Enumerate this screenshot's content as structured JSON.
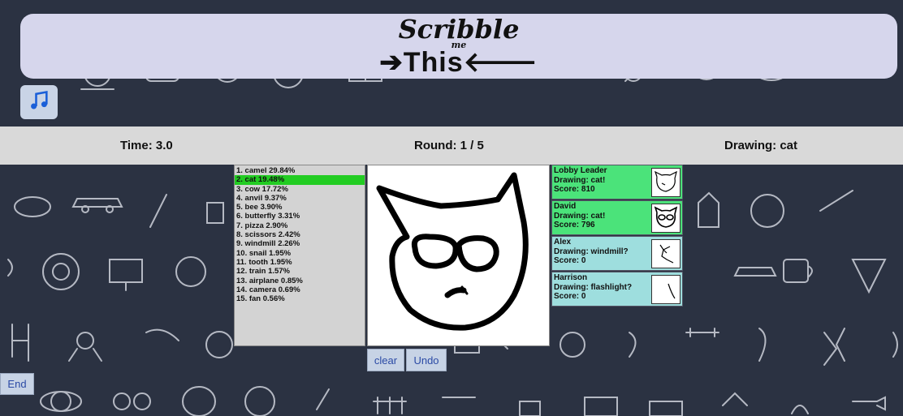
{
  "header": {
    "logo_word1": "Scribble",
    "logo_word2": "me",
    "logo_word3": "➔This🡐"
  },
  "status": {
    "time": "Time: 3.0",
    "round": "Round: 1 / 5",
    "drawing": "Drawing: cat"
  },
  "guesses": [
    {
      "label": "1. camel 29.84%"
    },
    {
      "label": "2. cat 19.48%",
      "active": true
    },
    {
      "label": "3. cow 17.72%"
    },
    {
      "label": "4. anvil 9.37%"
    },
    {
      "label": "5. bee 3.90%"
    },
    {
      "label": "6. butterfly 3.31%"
    },
    {
      "label": "7. pizza 2.90%"
    },
    {
      "label": "8. scissors 2.42%"
    },
    {
      "label": "9. windmill 2.26%"
    },
    {
      "label": "10. snail 1.95%"
    },
    {
      "label": "11. tooth 1.95%"
    },
    {
      "label": "12. train 1.57%"
    },
    {
      "label": "13. airplane 0.85%"
    },
    {
      "label": "14. camera 0.69%"
    },
    {
      "label": "15. fan 0.56%"
    }
  ],
  "controls": {
    "clear_label": "clear",
    "undo_label": "Undo",
    "end_label": "End"
  },
  "players": [
    {
      "name": "Lobby Leader",
      "drawing": "Drawing: cat!",
      "score": "Score: 810",
      "color": "#4be37a"
    },
    {
      "name": "David",
      "drawing": "Drawing: cat!",
      "score": "Score: 796",
      "color": "#4be37a"
    },
    {
      "name": "Alex",
      "drawing": "Drawing: windmill?",
      "score": "Score: 0",
      "color": "#9edede"
    },
    {
      "name": "Harrison",
      "drawing": "Drawing: flashlight?",
      "score": "Score: 0",
      "color": "#9edede"
    }
  ],
  "icons": {
    "music": "music-note-icon"
  },
  "colors": {
    "background": "#2b3242",
    "banner": "#d6d6ec",
    "status_bar": "#d9d9d9",
    "active_guess": "#22cc22",
    "correct_player": "#4be37a",
    "pending_player": "#9edede"
  }
}
